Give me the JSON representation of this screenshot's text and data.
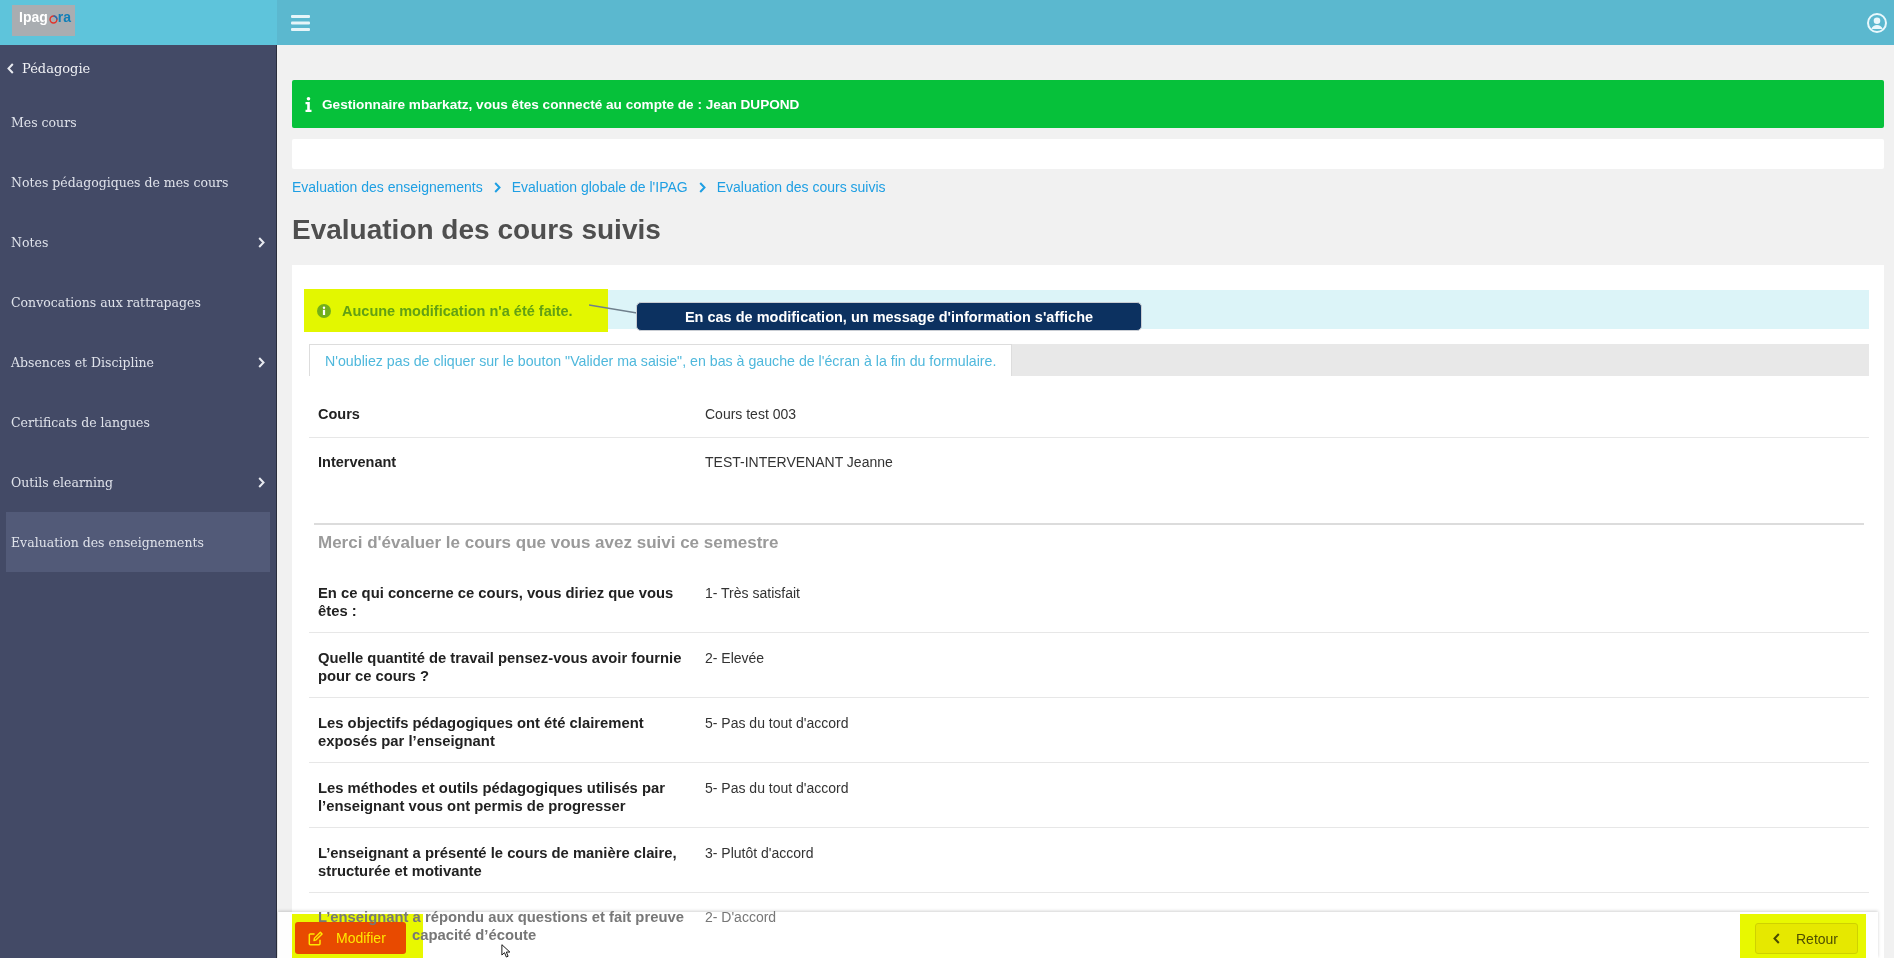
{
  "header": {
    "logo": {
      "lead": "Ipag",
      "tail": "ra"
    }
  },
  "sidebar": {
    "back": "Pédagogie",
    "items": [
      {
        "label": "Mes cours",
        "selected": false,
        "has_submenu": false
      },
      {
        "label": "Notes pédagogiques de mes cours",
        "selected": false,
        "has_submenu": false
      },
      {
        "label": "Notes",
        "selected": false,
        "has_submenu": true
      },
      {
        "label": "Convocations aux rattrapages",
        "selected": false,
        "has_submenu": false
      },
      {
        "label": "Absences et Discipline",
        "selected": false,
        "has_submenu": true
      },
      {
        "label": "Certificats de langues",
        "selected": false,
        "has_submenu": false
      },
      {
        "label": "Outils elearning",
        "selected": false,
        "has_submenu": true
      },
      {
        "label": "Evaluation des enseignements",
        "selected": true,
        "has_submenu": false
      }
    ]
  },
  "banner": {
    "text": "Gestionnaire mbarkatz, vous êtes connecté au compte de : Jean DUPOND"
  },
  "breadcrumbs": [
    "Evaluation des enseignements",
    "Evaluation globale de l'IPAG",
    "Evaluation des cours suivis"
  ],
  "page_title": "Evaluation des cours suivis",
  "alert": {
    "text": "Aucune modification n'a été faite.",
    "highlighted": true,
    "callout": "En cas de modification, un message d'information s'affiche"
  },
  "tabs": [
    {
      "label": "N'oubliez pas de cliquer sur le bouton \"Valider ma saisie\", en bas à gauche de l'écran à la fin du formulaire.",
      "selected": true
    }
  ],
  "course_info": [
    {
      "label": "Cours",
      "value": "Cours test 003"
    },
    {
      "label": "Intervenant",
      "value": "TEST-INTERVENANT Jeanne"
    }
  ],
  "evaluation": {
    "heading": "Merci d'évaluer le cours que vous avez suivi ce semestre",
    "questions": [
      {
        "label": "En ce qui concerne ce cours, vous diriez que vous êtes :",
        "value": "1- Très satisfait"
      },
      {
        "label": "Quelle quantité de travail pensez-vous avoir fournie pour ce cours ?",
        "value": "2- Elevée"
      },
      {
        "label": "Les objectifs pédagogiques ont été clairement exposés par l’enseignant",
        "value": "5- Pas du tout d'accord"
      },
      {
        "label": "Les méthodes et outils pédagogiques utilisés par l’enseignant vous ont permis de progresser",
        "value": "5- Pas du tout d'accord"
      },
      {
        "label": "L’enseignant a présenté le cours de manière claire, structurée et motivante",
        "value": "3- Plutôt d'accord"
      },
      {
        "label": "L’enseignant a répondu aux questions et fait preuve",
        "label_rest": "capacité d’écoute",
        "value": "2- D'accord"
      }
    ]
  },
  "footer": {
    "buttons": [
      {
        "label": "Modifier",
        "kind": "edit",
        "highlighted": true
      },
      {
        "label": "Retour",
        "kind": "back",
        "highlighted": true
      }
    ]
  }
}
